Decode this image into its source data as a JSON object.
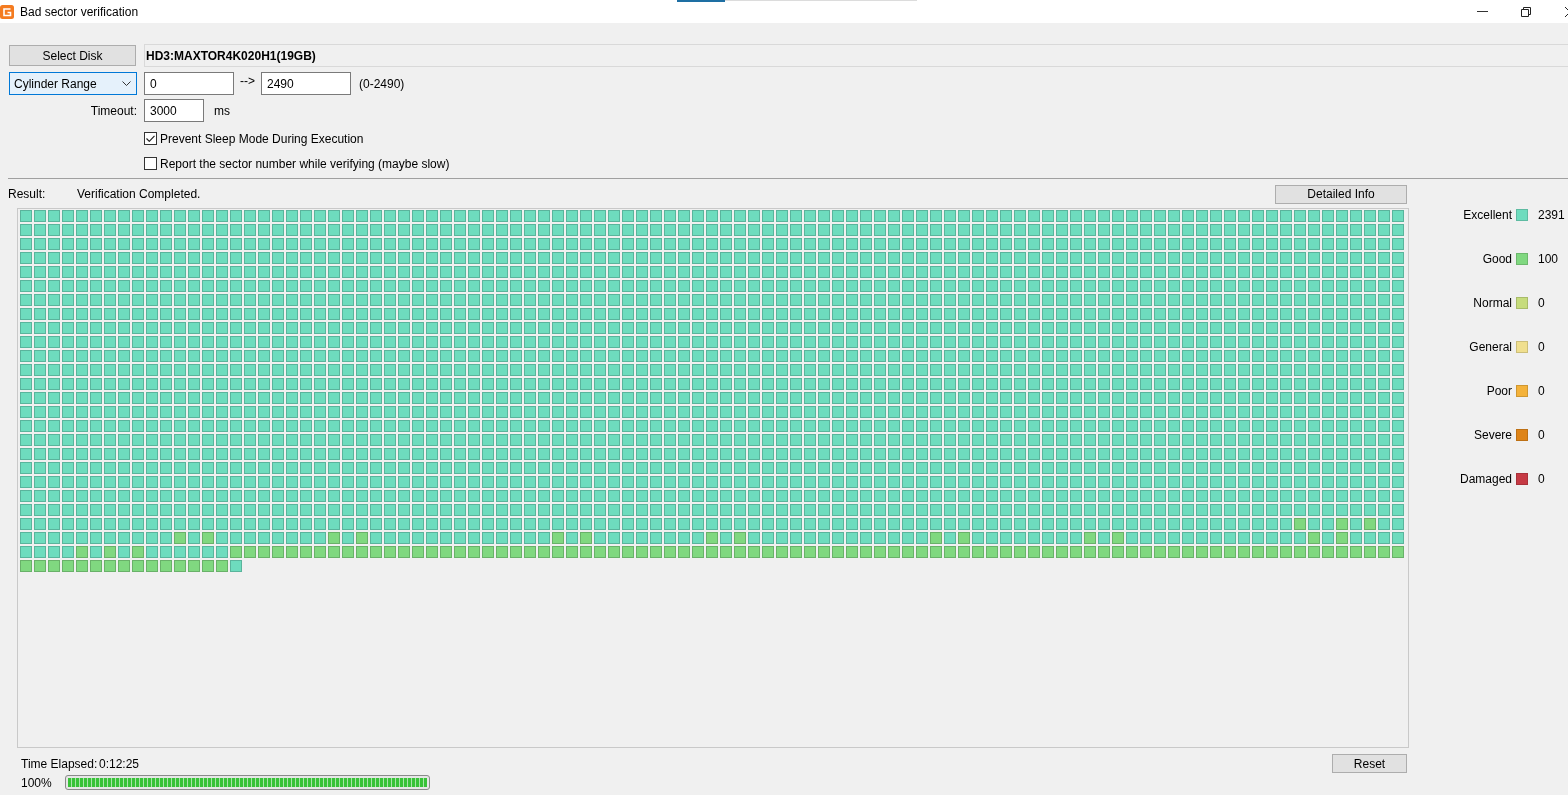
{
  "window": {
    "title": "Bad sector verification"
  },
  "disk": {
    "button": "Select Disk",
    "name": "HD3:MAXTOR4K020H1(19GB)"
  },
  "range": {
    "mode": {
      "label": "Cylinder Range",
      "focused": true
    },
    "start": "0",
    "separator": "-->",
    "end": "2490",
    "limits": "(0-2490)"
  },
  "timeout": {
    "label": "Timeout:",
    "value": "3000",
    "unit": "ms"
  },
  "options": [
    {
      "label": "Prevent Sleep Mode During Execution",
      "checked": true
    },
    {
      "label": "Report the sector number while verifying (maybe slow)",
      "checked": false
    }
  ],
  "result": {
    "label": "Result:",
    "status": "Verification Completed.",
    "button": "Detailed Info"
  },
  "sector_map": {
    "good": [
      [
        false,
        false,
        false,
        false,
        false,
        false,
        false,
        false,
        false,
        false,
        false,
        false,
        false,
        false,
        false,
        false,
        false,
        false,
        false,
        false,
        false,
        false,
        false,
        false,
        false,
        false,
        false,
        false,
        false,
        false,
        false,
        false,
        false,
        false,
        false,
        false,
        false,
        false,
        false,
        false,
        false,
        false,
        false,
        false,
        false,
        false,
        false,
        false,
        false,
        false,
        false,
        false,
        false,
        false,
        false,
        false,
        false,
        false,
        false,
        false,
        false,
        false,
        false,
        false,
        false,
        false,
        false,
        false,
        false,
        false,
        false,
        false,
        false,
        false,
        false,
        false,
        false,
        false,
        false,
        false,
        false,
        false,
        false,
        false,
        false,
        false,
        false,
        false,
        false,
        false,
        false,
        false,
        false,
        false,
        false,
        false,
        false,
        false,
        false
      ],
      [
        false,
        false,
        false,
        false,
        false,
        false,
        false,
        false,
        false,
        false,
        false,
        false,
        false,
        false,
        false,
        false,
        false,
        false,
        false,
        false,
        false,
        false,
        false,
        false,
        false,
        false,
        false,
        false,
        false,
        false,
        false,
        false,
        false,
        false,
        false,
        false,
        false,
        false,
        false,
        false,
        false,
        false,
        false,
        false,
        false,
        false,
        false,
        false,
        false,
        false,
        false,
        false,
        false,
        false,
        false,
        false,
        false,
        false,
        false,
        false,
        false,
        false,
        false,
        false,
        false,
        false,
        false,
        false,
        false,
        false,
        false,
        false,
        false,
        false,
        false,
        false,
        false,
        false,
        false,
        false,
        false,
        false,
        false,
        false,
        false,
        false,
        false,
        false,
        false,
        false,
        false,
        false,
        false,
        false,
        false,
        false,
        false,
        false,
        false
      ],
      [
        false,
        false,
        false,
        false,
        false,
        false,
        false,
        false,
        false,
        false,
        false,
        false,
        false,
        false,
        false,
        false,
        false,
        false,
        false,
        false,
        false,
        false,
        false,
        false,
        false,
        false,
        false,
        false,
        false,
        false,
        false,
        false,
        false,
        false,
        false,
        false,
        false,
        false,
        false,
        false,
        false,
        false,
        false,
        false,
        false,
        false,
        false,
        false,
        false,
        false,
        false,
        false,
        false,
        false,
        false,
        false,
        false,
        false,
        false,
        false,
        false,
        false,
        false,
        false,
        false,
        false,
        false,
        false,
        false,
        false,
        false,
        false,
        false,
        false,
        false,
        false,
        false,
        false,
        false,
        false,
        false,
        false,
        false,
        false,
        false,
        false,
        false,
        false,
        false,
        false,
        false,
        false,
        false,
        false,
        false,
        false,
        false,
        false,
        false
      ],
      [
        false,
        false,
        false,
        false,
        false,
        false,
        false,
        false,
        false,
        false,
        false,
        false,
        false,
        false,
        false,
        false,
        false,
        false,
        false,
        false,
        false,
        false,
        false,
        false,
        false,
        false,
        false,
        false,
        false,
        false,
        false,
        false,
        false,
        false,
        false,
        false,
        false,
        false,
        false,
        false,
        false,
        false,
        false,
        false,
        false,
        false,
        false,
        false,
        false,
        false,
        false,
        false,
        false,
        false,
        false,
        false,
        false,
        false,
        false,
        false,
        false,
        false,
        false,
        false,
        false,
        false,
        false,
        false,
        false,
        false,
        false,
        false,
        false,
        false,
        false,
        false,
        false,
        false,
        false,
        false,
        false,
        false,
        false,
        false,
        false,
        false,
        false,
        false,
        false,
        false,
        false,
        false,
        false,
        false,
        false,
        false,
        false,
        false,
        false
      ],
      [
        false,
        false,
        false,
        false,
        false,
        false,
        false,
        false,
        false,
        false,
        false,
        false,
        false,
        false,
        false,
        false,
        false,
        false,
        false,
        false,
        false,
        false,
        false,
        false,
        false,
        false,
        false,
        false,
        false,
        false,
        false,
        false,
        false,
        false,
        false,
        false,
        false,
        false,
        false,
        false,
        false,
        false,
        false,
        false,
        false,
        false,
        false,
        false,
        false,
        false,
        false,
        false,
        false,
        false,
        false,
        false,
        false,
        false,
        false,
        false,
        false,
        false,
        false,
        false,
        false,
        false,
        false,
        false,
        false,
        false,
        false,
        false,
        false,
        false,
        false,
        false,
        false,
        false,
        false,
        false,
        false,
        false,
        false,
        false,
        false,
        false,
        false,
        false,
        false,
        false,
        false,
        false,
        false,
        false,
        false,
        false,
        false,
        false,
        false
      ],
      [
        false,
        false,
        false,
        false,
        false,
        false,
        false,
        false,
        false,
        false,
        false,
        false,
        false,
        false,
        false,
        false,
        false,
        false,
        false,
        false,
        false,
        false,
        false,
        false,
        false,
        false,
        false,
        false,
        false,
        false,
        false,
        false,
        false,
        false,
        false,
        false,
        false,
        false,
        false,
        false,
        false,
        false,
        false,
        false,
        false,
        false,
        false,
        false,
        false,
        false,
        false,
        false,
        false,
        false,
        false,
        false,
        false,
        false,
        false,
        false,
        false,
        false,
        false,
        false,
        false,
        false,
        false,
        false,
        false,
        false,
        false,
        false,
        false,
        false,
        false,
        false,
        false,
        false,
        false,
        false,
        false,
        false,
        false,
        false,
        false,
        false,
        false,
        false,
        false,
        false,
        false,
        false,
        false,
        false,
        false,
        false,
        false,
        false,
        false
      ],
      [
        false,
        false,
        false,
        false,
        false,
        false,
        false,
        false,
        false,
        false,
        false,
        false,
        false,
        false,
        false,
        false,
        false,
        false,
        false,
        false,
        false,
        false,
        false,
        false,
        false,
        false,
        false,
        false,
        false,
        false,
        false,
        false,
        false,
        false,
        false,
        false,
        false,
        false,
        false,
        false,
        false,
        false,
        false,
        false,
        false,
        false,
        false,
        false,
        false,
        false,
        false,
        false,
        false,
        false,
        false,
        false,
        false,
        false,
        false,
        false,
        false,
        false,
        false,
        false,
        false,
        false,
        false,
        false,
        false,
        false,
        false,
        false,
        false,
        false,
        false,
        false,
        false,
        false,
        false,
        false,
        false,
        false,
        false,
        false,
        false,
        false,
        false,
        false,
        false,
        false,
        false,
        false,
        false,
        false,
        false,
        false,
        false,
        false,
        false
      ],
      [
        false,
        false,
        false,
        false,
        false,
        false,
        false,
        false,
        false,
        false,
        false,
        false,
        false,
        false,
        false,
        false,
        false,
        false,
        false,
        false,
        false,
        false,
        false,
        false,
        false,
        false,
        false,
        false,
        false,
        false,
        false,
        false,
        false,
        false,
        false,
        false,
        false,
        false,
        false,
        false,
        false,
        false,
        false,
        false,
        false,
        false,
        false,
        false,
        false,
        false,
        false,
        false,
        false,
        false,
        false,
        false,
        false,
        false,
        false,
        false,
        false,
        false,
        false,
        false,
        false,
        false,
        false,
        false,
        false,
        false,
        false,
        false,
        false,
        false,
        false,
        false,
        false,
        false,
        false,
        false,
        false,
        false,
        false,
        false,
        false,
        false,
        false,
        false,
        false,
        false,
        false,
        false,
        false,
        false,
        false,
        false,
        false,
        false,
        false
      ],
      [
        false,
        false,
        false,
        false,
        false,
        false,
        false,
        false,
        false,
        false,
        false,
        false,
        false,
        false,
        false,
        false,
        false,
        false,
        false,
        false,
        false,
        false,
        false,
        false,
        false,
        false,
        false,
        false,
        false,
        false,
        false,
        false,
        false,
        false,
        false,
        false,
        false,
        false,
        false,
        false,
        false,
        false,
        false,
        false,
        false,
        false,
        false,
        false,
        false,
        false,
        false,
        false,
        false,
        false,
        false,
        false,
        false,
        false,
        false,
        false,
        false,
        false,
        false,
        false,
        false,
        false,
        false,
        false,
        false,
        false,
        false,
        false,
        false,
        false,
        false,
        false,
        false,
        false,
        false,
        false,
        false,
        false,
        false,
        false,
        false,
        false,
        false,
        false,
        false,
        false,
        false,
        false,
        false,
        false,
        false,
        false,
        false,
        false,
        false
      ],
      [
        false,
        false,
        false,
        false,
        false,
        false,
        false,
        false,
        false,
        false,
        false,
        false,
        false,
        false,
        false,
        false,
        false,
        false,
        false,
        false,
        false,
        false,
        false,
        false,
        false,
        false,
        false,
        false,
        false,
        false,
        false,
        false,
        false,
        false,
        false,
        false,
        false,
        false,
        false,
        false,
        false,
        false,
        false,
        false,
        false,
        false,
        false,
        false,
        false,
        false,
        false,
        false,
        false,
        false,
        false,
        false,
        false,
        false,
        false,
        false,
        false,
        false,
        false,
        false,
        false,
        false,
        false,
        false,
        false,
        false,
        false,
        false,
        false,
        false,
        false,
        false,
        false,
        false,
        false,
        false,
        false,
        false,
        false,
        false,
        false,
        false,
        false,
        false,
        false,
        false,
        false,
        false,
        false,
        false,
        false,
        false,
        false,
        false,
        false
      ],
      [
        false,
        false,
        false,
        false,
        false,
        false,
        false,
        false,
        false,
        false,
        false,
        false,
        false,
        false,
        false,
        false,
        false,
        false,
        false,
        false,
        false,
        false,
        false,
        false,
        false,
        false,
        false,
        false,
        false,
        false,
        false,
        false,
        false,
        false,
        false,
        false,
        false,
        false,
        false,
        false,
        false,
        false,
        false,
        false,
        false,
        false,
        false,
        false,
        false,
        false,
        false,
        false,
        false,
        false,
        false,
        false,
        false,
        false,
        false,
        false,
        false,
        false,
        false,
        false,
        false,
        false,
        false,
        false,
        false,
        false,
        false,
        false,
        false,
        false,
        false,
        false,
        false,
        false,
        false,
        false,
        false,
        false,
        false,
        false,
        false,
        false,
        false,
        false,
        false,
        false,
        false,
        false,
        false,
        false,
        false,
        false,
        false,
        false,
        false
      ],
      [
        false,
        false,
        false,
        false,
        false,
        false,
        false,
        false,
        false,
        false,
        false,
        false,
        false,
        false,
        false,
        false,
        false,
        false,
        false,
        false,
        false,
        false,
        false,
        false,
        false,
        false,
        false,
        false,
        false,
        false,
        false,
        false,
        false,
        false,
        false,
        false,
        false,
        false,
        false,
        false,
        false,
        false,
        false,
        false,
        false,
        false,
        false,
        false,
        false,
        false,
        false,
        false,
        false,
        false,
        false,
        false,
        false,
        false,
        false,
        false,
        false,
        false,
        false,
        false,
        false,
        false,
        false,
        false,
        false,
        false,
        false,
        false,
        false,
        false,
        false,
        false,
        false,
        false,
        false,
        false,
        false,
        false,
        false,
        false,
        false,
        false,
        false,
        false,
        false,
        false,
        false,
        false,
        false,
        false,
        false,
        false,
        false,
        false,
        false
      ],
      [
        false,
        false,
        false,
        false,
        false,
        false,
        false,
        false,
        false,
        false,
        false,
        false,
        false,
        false,
        false,
        false,
        false,
        false,
        false,
        false,
        false,
        false,
        false,
        false,
        false,
        false,
        false,
        false,
        false,
        false,
        false,
        false,
        false,
        false,
        false,
        false,
        false,
        false,
        false,
        false,
        false,
        false,
        false,
        false,
        false,
        false,
        false,
        false,
        false,
        false,
        false,
        false,
        false,
        false,
        false,
        false,
        false,
        false,
        false,
        false,
        false,
        false,
        false,
        false,
        false,
        false,
        false,
        false,
        false,
        false,
        false,
        false,
        false,
        false,
        false,
        false,
        false,
        false,
        false,
        false,
        false,
        false,
        false,
        false,
        false,
        false,
        false,
        false,
        false,
        false,
        false,
        false,
        false,
        false,
        false,
        false,
        false,
        false,
        false
      ],
      [
        false,
        false,
        false,
        false,
        false,
        false,
        false,
        false,
        false,
        false,
        false,
        false,
        false,
        false,
        false,
        false,
        false,
        false,
        false,
        false,
        false,
        false,
        false,
        false,
        false,
        false,
        false,
        false,
        false,
        false,
        false,
        false,
        false,
        false,
        false,
        false,
        false,
        false,
        false,
        false,
        false,
        false,
        false,
        false,
        false,
        false,
        false,
        false,
        false,
        false,
        false,
        false,
        false,
        false,
        false,
        false,
        false,
        false,
        false,
        false,
        false,
        false,
        false,
        false,
        false,
        false,
        false,
        false,
        false,
        false,
        false,
        false,
        false,
        false,
        false,
        false,
        false,
        false,
        false,
        false,
        false,
        false,
        false,
        false,
        false,
        false,
        false,
        false,
        false,
        false,
        false,
        false,
        false,
        false,
        false,
        false,
        false,
        false,
        false
      ],
      [
        false,
        false,
        false,
        false,
        false,
        false,
        false,
        false,
        false,
        false,
        false,
        false,
        false,
        false,
        false,
        false,
        false,
        false,
        false,
        false,
        false,
        false,
        false,
        false,
        false,
        false,
        false,
        false,
        false,
        false,
        false,
        false,
        false,
        false,
        false,
        false,
        false,
        false,
        false,
        false,
        false,
        false,
        false,
        false,
        false,
        false,
        false,
        false,
        false,
        false,
        false,
        false,
        false,
        false,
        false,
        false,
        false,
        false,
        false,
        false,
        false,
        false,
        false,
        false,
        false,
        false,
        false,
        false,
        false,
        false,
        false,
        false,
        false,
        false,
        false,
        false,
        false,
        false,
        false,
        false,
        false,
        false,
        false,
        false,
        false,
        false,
        false,
        false,
        false,
        false,
        false,
        false,
        false,
        false,
        false,
        false,
        false,
        false,
        false
      ],
      [
        false,
        false,
        false,
        false,
        false,
        false,
        false,
        false,
        false,
        false,
        false,
        false,
        false,
        false,
        false,
        false,
        false,
        false,
        false,
        false,
        false,
        false,
        false,
        false,
        false,
        false,
        false,
        false,
        false,
        false,
        false,
        false,
        false,
        false,
        false,
        false,
        false,
        false,
        false,
        false,
        false,
        false,
        false,
        false,
        false,
        false,
        false,
        false,
        false,
        false,
        false,
        false,
        false,
        false,
        false,
        false,
        false,
        false,
        false,
        false,
        false,
        false,
        false,
        false,
        false,
        false,
        false,
        false,
        false,
        false,
        false,
        false,
        false,
        false,
        false,
        false,
        false,
        false,
        false,
        false,
        false,
        false,
        false,
        false,
        false,
        false,
        false,
        false,
        false,
        false,
        false,
        false,
        false,
        false,
        false,
        false,
        false,
        false,
        false
      ],
      [
        false,
        false,
        false,
        false,
        false,
        false,
        false,
        false,
        false,
        false,
        false,
        false,
        false,
        false,
        false,
        false,
        false,
        false,
        false,
        false,
        false,
        false,
        false,
        false,
        false,
        false,
        false,
        false,
        false,
        false,
        false,
        false,
        false,
        false,
        false,
        false,
        false,
        false,
        false,
        false,
        false,
        false,
        false,
        false,
        false,
        false,
        false,
        false,
        false,
        false,
        false,
        false,
        false,
        false,
        false,
        false,
        false,
        false,
        false,
        false,
        false,
        false,
        false,
        false,
        false,
        false,
        false,
        false,
        false,
        false,
        false,
        false,
        false,
        false,
        false,
        false,
        false,
        false,
        false,
        false,
        false,
        false,
        false,
        false,
        false,
        false,
        false,
        false,
        false,
        false,
        false,
        false,
        false,
        false,
        false,
        false,
        false,
        false,
        false
      ],
      [
        false,
        false,
        false,
        false,
        false,
        false,
        false,
        false,
        false,
        false,
        false,
        false,
        false,
        false,
        false,
        false,
        false,
        false,
        false,
        false,
        false,
        false,
        false,
        false,
        false,
        false,
        false,
        false,
        false,
        false,
        false,
        false,
        false,
        false,
        false,
        false,
        false,
        false,
        false,
        false,
        false,
        false,
        false,
        false,
        false,
        false,
        false,
        false,
        false,
        false,
        false,
        false,
        false,
        false,
        false,
        false,
        false,
        false,
        false,
        false,
        false,
        false,
        false,
        false,
        false,
        false,
        false,
        false,
        false,
        false,
        false,
        false,
        false,
        false,
        false,
        false,
        false,
        false,
        false,
        false,
        false,
        false,
        false,
        false,
        false,
        false,
        false,
        false,
        false,
        false,
        false,
        false,
        false,
        false,
        false,
        false,
        false,
        false,
        false
      ],
      [
        false,
        false,
        false,
        false,
        false,
        false,
        false,
        false,
        false,
        false,
        false,
        false,
        false,
        false,
        false,
        false,
        false,
        false,
        false,
        false,
        false,
        false,
        false,
        false,
        false,
        false,
        false,
        false,
        false,
        false,
        false,
        false,
        false,
        false,
        false,
        false,
        false,
        false,
        false,
        false,
        false,
        false,
        false,
        false,
        false,
        false,
        false,
        false,
        false,
        false,
        false,
        false,
        false,
        false,
        false,
        false,
        false,
        false,
        false,
        false,
        false,
        false,
        false,
        false,
        false,
        false,
        false,
        false,
        false,
        false,
        false,
        false,
        false,
        false,
        false,
        false,
        false,
        false,
        false,
        false,
        false,
        false,
        false,
        false,
        false,
        false,
        false,
        false,
        false,
        false,
        false,
        false,
        false,
        false,
        false,
        false,
        false,
        false,
        false
      ],
      [
        false,
        false,
        false,
        false,
        false,
        false,
        false,
        false,
        false,
        false,
        false,
        false,
        false,
        false,
        false,
        false,
        false,
        false,
        false,
        false,
        false,
        false,
        false,
        false,
        false,
        false,
        false,
        false,
        false,
        false,
        false,
        false,
        false,
        false,
        false,
        false,
        false,
        false,
        false,
        false,
        false,
        false,
        false,
        false,
        false,
        false,
        false,
        false,
        false,
        false,
        false,
        false,
        false,
        false,
        false,
        false,
        false,
        false,
        false,
        false,
        false,
        false,
        false,
        false,
        false,
        false,
        false,
        false,
        false,
        false,
        false,
        false,
        false,
        false,
        false,
        false,
        false,
        false,
        false,
        false,
        false,
        false,
        false,
        false,
        false,
        false,
        false,
        false,
        false,
        false,
        false,
        false,
        false,
        false,
        false,
        false,
        false,
        false,
        false
      ],
      [
        false,
        false,
        false,
        false,
        false,
        false,
        false,
        false,
        false,
        false,
        false,
        false,
        false,
        false,
        false,
        false,
        false,
        false,
        false,
        false,
        false,
        false,
        false,
        false,
        false,
        false,
        false,
        false,
        false,
        false,
        false,
        false,
        false,
        false,
        false,
        false,
        false,
        false,
        false,
        false,
        false,
        false,
        false,
        false,
        false,
        false,
        false,
        false,
        false,
        false,
        false,
        false,
        false,
        false,
        false,
        false,
        false,
        false,
        false,
        false,
        false,
        false,
        false,
        false,
        false,
        false,
        false,
        false,
        false,
        false,
        false,
        false,
        false,
        false,
        false,
        false,
        false,
        false,
        false,
        false,
        false,
        false,
        false,
        false,
        false,
        false,
        false,
        false,
        false,
        false,
        false,
        false,
        false,
        false,
        false,
        false,
        false,
        false,
        false
      ],
      [
        false,
        false,
        false,
        false,
        false,
        false,
        false,
        false,
        false,
        false,
        false,
        false,
        false,
        false,
        false,
        false,
        false,
        false,
        false,
        false,
        false,
        false,
        false,
        false,
        false,
        false,
        false,
        false,
        false,
        false,
        false,
        false,
        false,
        false,
        false,
        false,
        false,
        false,
        false,
        false,
        false,
        false,
        false,
        false,
        false,
        false,
        false,
        false,
        false,
        false,
        false,
        false,
        false,
        false,
        false,
        false,
        false,
        false,
        false,
        false,
        false,
        false,
        false,
        false,
        false,
        false,
        false,
        false,
        false,
        false,
        false,
        false,
        false,
        false,
        false,
        false,
        false,
        false,
        false,
        false,
        false,
        false,
        false,
        false,
        false,
        false,
        false,
        false,
        false,
        false,
        false,
        false,
        false,
        false,
        false,
        false,
        false,
        false,
        false
      ],
      [
        false,
        false,
        false,
        false,
        false,
        false,
        false,
        false,
        false,
        false,
        false,
        false,
        false,
        false,
        false,
        false,
        false,
        false,
        false,
        false,
        false,
        false,
        false,
        false,
        false,
        false,
        false,
        false,
        false,
        false,
        false,
        false,
        false,
        false,
        false,
        false,
        false,
        false,
        false,
        false,
        false,
        false,
        false,
        false,
        false,
        false,
        false,
        false,
        false,
        false,
        false,
        false,
        false,
        false,
        false,
        false,
        false,
        false,
        false,
        false,
        false,
        false,
        false,
        false,
        false,
        false,
        false,
        false,
        false,
        false,
        false,
        false,
        false,
        false,
        false,
        false,
        false,
        false,
        false,
        false,
        false,
        false,
        false,
        false,
        false,
        false,
        false,
        false,
        false,
        false,
        false,
        true,
        false,
        false,
        true,
        false,
        true,
        false,
        false
      ],
      [
        false,
        false,
        false,
        false,
        false,
        false,
        false,
        false,
        false,
        false,
        false,
        true,
        false,
        true,
        false,
        false,
        false,
        false,
        false,
        false,
        false,
        false,
        true,
        false,
        true,
        false,
        false,
        false,
        false,
        false,
        false,
        false,
        false,
        false,
        false,
        false,
        false,
        false,
        true,
        false,
        true,
        false,
        false,
        false,
        false,
        false,
        false,
        false,
        false,
        true,
        false,
        true,
        false,
        false,
        false,
        false,
        false,
        false,
        false,
        false,
        false,
        false,
        false,
        false,
        false,
        true,
        false,
        true,
        false,
        false,
        false,
        false,
        false,
        false,
        false,
        false,
        true,
        false,
        true,
        false,
        false,
        false,
        false,
        false,
        false,
        false,
        false,
        false,
        false,
        false,
        false,
        false,
        true,
        false,
        true,
        false,
        false,
        false,
        false
      ],
      [
        false,
        false,
        false,
        false,
        true,
        false,
        true,
        false,
        true,
        false,
        false,
        false,
        false,
        false,
        false,
        true,
        true,
        true,
        true,
        true,
        true,
        true,
        true,
        true,
        true,
        true,
        true,
        true,
        true,
        true,
        true,
        true,
        true,
        true,
        true,
        true,
        true,
        true,
        true,
        true,
        true,
        true,
        true,
        true,
        true,
        true,
        true,
        true,
        true,
        true,
        true,
        true,
        true,
        true,
        true,
        true,
        true,
        true,
        true,
        true,
        true,
        true,
        true,
        true,
        true,
        true,
        true,
        true,
        true,
        true,
        true,
        true,
        true,
        true,
        true,
        true,
        true,
        true,
        true,
        true,
        true,
        true,
        true,
        true,
        true,
        true,
        true,
        true,
        true,
        true,
        true,
        true,
        true,
        true,
        true,
        true,
        true,
        true,
        true
      ],
      [
        true,
        true,
        true,
        true,
        true,
        true,
        true,
        true,
        true,
        true,
        true,
        true,
        true,
        true,
        true,
        false
      ]
    ]
  },
  "legend": [
    {
      "label": "Excellent",
      "color": "#6edcbe",
      "count": "2391"
    },
    {
      "label": "Good",
      "color": "#80d880",
      "count": "100"
    },
    {
      "label": "Normal",
      "color": "#c6dc7c",
      "count": "0"
    },
    {
      "label": "General",
      "color": "#f0df8e",
      "count": "0"
    },
    {
      "label": "Poor",
      "color": "#f4b23a",
      "count": "0"
    },
    {
      "label": "Severe",
      "color": "#de8418",
      "count": "0"
    },
    {
      "label": "Damaged",
      "color": "#c63a44",
      "count": "0"
    }
  ],
  "footer": {
    "elapsed_label": "Time Elapsed:",
    "elapsed": "0:12:25",
    "percent": "100%",
    "level": 1,
    "button": "Reset"
  }
}
